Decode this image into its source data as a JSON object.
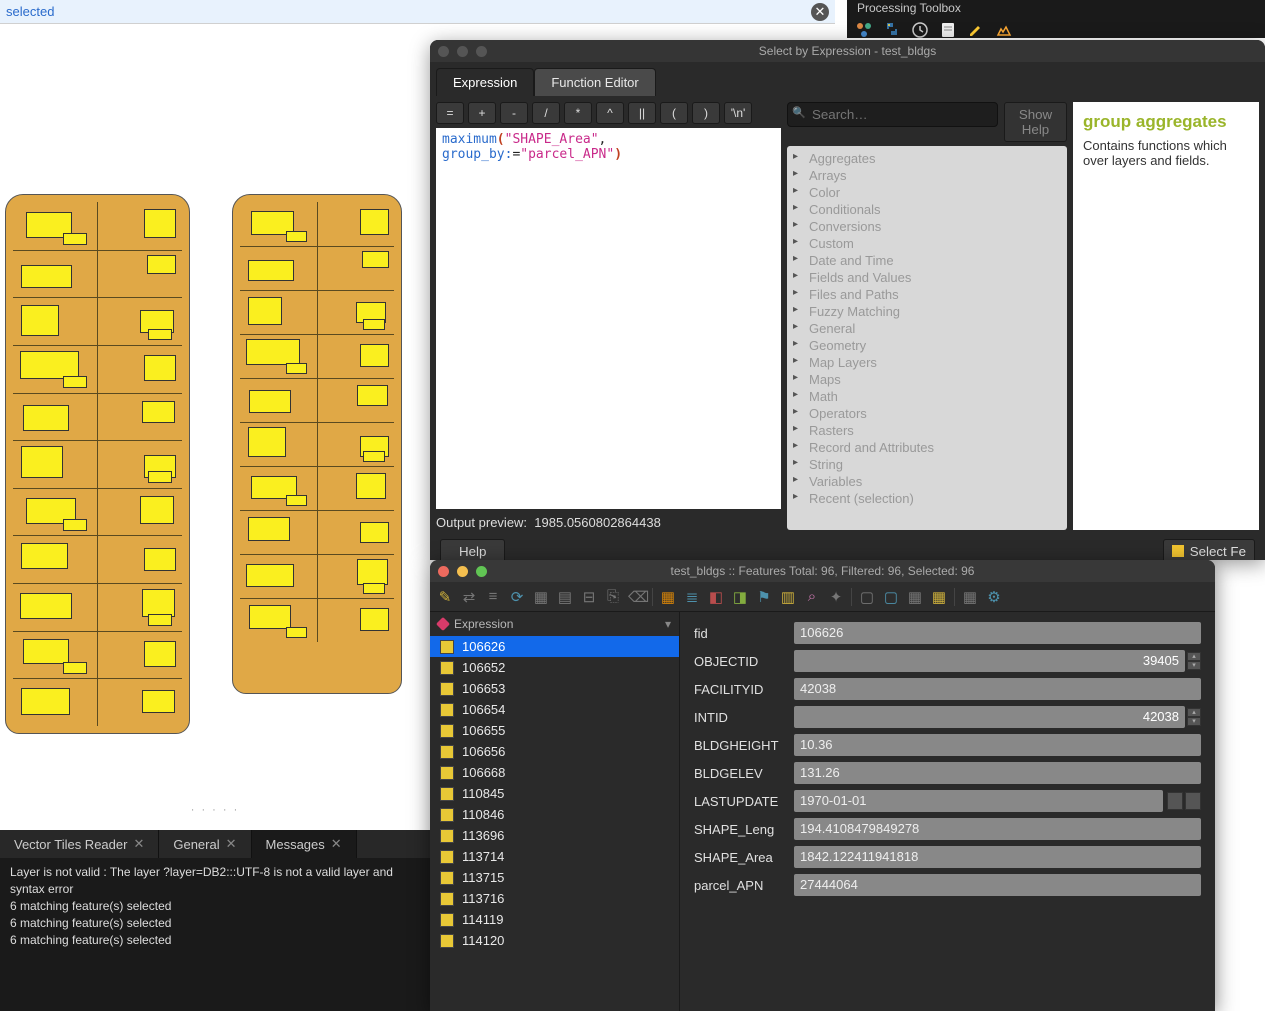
{
  "topbar": {
    "label": "selected"
  },
  "log": {
    "tabs": [
      "Vector Tiles Reader",
      "General",
      "Messages"
    ],
    "active": 2,
    "lines": [
      "Layer is not valid : The layer ?layer=DB2:::UTF-8 is not a valid layer and",
      "syntax error",
      "6 matching feature(s) selected",
      "6 matching feature(s) selected",
      "6 matching feature(s) selected"
    ]
  },
  "ptoolbox": {
    "title": "Processing Toolbox"
  },
  "expr_dialog": {
    "title": "Select by Expression - test_bldgs",
    "tabs": [
      "Expression",
      "Function Editor"
    ],
    "operators": [
      "=",
      "+",
      "-",
      "/",
      "*",
      "^",
      "||",
      "(",
      ")",
      "'\\n'"
    ],
    "expr_parts": {
      "func": "maximum",
      "p1": "(",
      "field": "\"SHAPE_Area\"",
      "comma": ", ",
      "arg": "group_by:",
      "eq": "=",
      "str": "\"parcel_APN\"",
      "p2": ")"
    },
    "output_label": "Output preview:",
    "output_value": "1985.0560802864438",
    "search_placeholder": "Search…",
    "showhelp": "Show Help",
    "tree": [
      "Aggregates",
      "Arrays",
      "Color",
      "Conditionals",
      "Conversions",
      "Custom",
      "Date and Time",
      "Fields and Values",
      "Files and Paths",
      "Fuzzy Matching",
      "General",
      "Geometry",
      "Map Layers",
      "Maps",
      "Math",
      "Operators",
      "Rasters",
      "Record and Attributes",
      "String",
      "Variables",
      "Recent (selection)"
    ],
    "help_title": "group aggregates",
    "help_body": "Contains functions which over layers and fields.",
    "help_btn": "Help",
    "select_fe": "Select Fe"
  },
  "attr_dialog": {
    "title": "test_bldgs :: Features Total: 96, Filtered: 96, Selected: 96",
    "expression_label": "Expression",
    "ids": [
      "106626",
      "106652",
      "106653",
      "106654",
      "106655",
      "106656",
      "106668",
      "110845",
      "110846",
      "113696",
      "113714",
      "113715",
      "113716",
      "114119",
      "114120"
    ],
    "selected": "106626",
    "fields": [
      {
        "name": "fid",
        "value": "106626",
        "type": "text"
      },
      {
        "name": "OBJECTID",
        "value": "39405",
        "type": "num"
      },
      {
        "name": "FACILITYID",
        "value": "42038",
        "type": "text"
      },
      {
        "name": "INTID",
        "value": "42038",
        "type": "num"
      },
      {
        "name": "BLDGHEIGHT",
        "value": "10.36",
        "type": "text"
      },
      {
        "name": "BLDGELEV",
        "value": "131.26",
        "type": "text"
      },
      {
        "name": "LASTUPDATE",
        "value": "1970-01-01",
        "type": "date"
      },
      {
        "name": "SHAPE_Leng",
        "value": "194.4108479849278",
        "type": "text"
      },
      {
        "name": "SHAPE_Area",
        "value": "1842.122411941818",
        "type": "text"
      },
      {
        "name": "parcel_APN",
        "value": "27444064",
        "type": "text"
      }
    ]
  }
}
